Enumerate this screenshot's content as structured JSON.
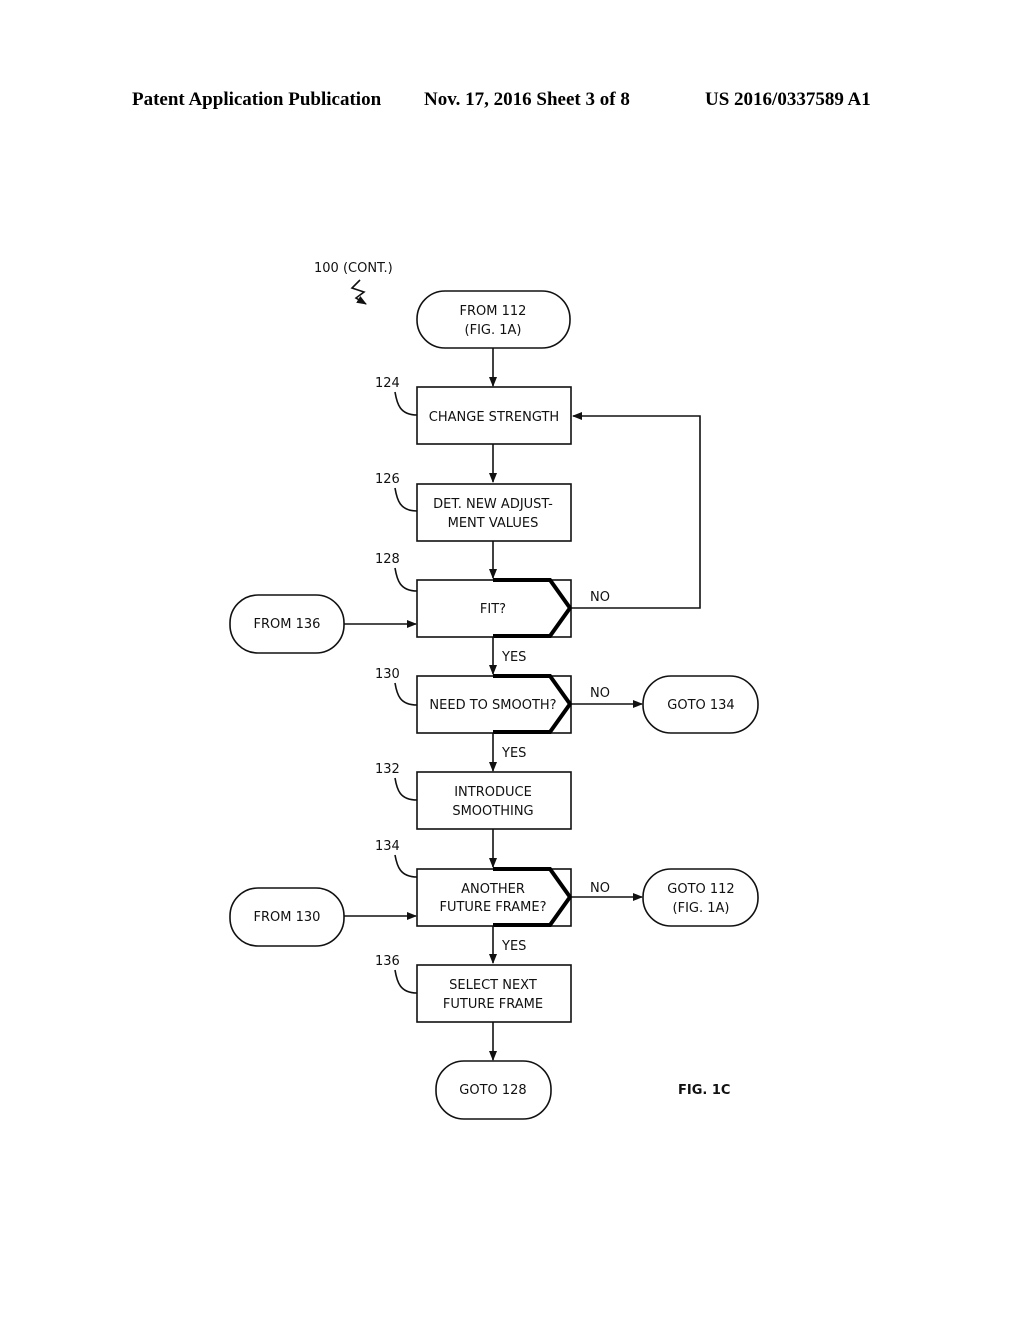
{
  "header": {
    "publication": "Patent Application Publication",
    "date_sheet": "Nov. 17, 2016  Sheet 3 of 8",
    "number": "US 2016/0337589 A1"
  },
  "diagram": {
    "ref_label": "100 (CONT.)",
    "figure_label": "FIG. 1C",
    "terminals": {
      "from_112": [
        "FROM 112",
        "(FIG. 1A)"
      ],
      "from_136": [
        "FROM 136"
      ],
      "goto_134": [
        "GOTO 134"
      ],
      "from_130": [
        "FROM 130"
      ],
      "goto_112": [
        "GOTO 112",
        "(FIG. 1A)"
      ],
      "goto_128": [
        "GOTO 128"
      ]
    },
    "steps": {
      "s124": {
        "ref": "124",
        "lines": [
          "CHANGE STRENGTH"
        ]
      },
      "s126": {
        "ref": "126",
        "lines": [
          "DET. NEW ADJUST-",
          "MENT VALUES"
        ]
      },
      "s128": {
        "ref": "128",
        "lines": [
          "FIT?"
        ]
      },
      "s130": {
        "ref": "130",
        "lines": [
          "NEED TO SMOOTH?"
        ]
      },
      "s132": {
        "ref": "132",
        "lines": [
          "INTRODUCE",
          "SMOOTHING"
        ]
      },
      "s134": {
        "ref": "134",
        "lines": [
          "ANOTHER",
          "FUTURE FRAME?"
        ]
      },
      "s136": {
        "ref": "136",
        "lines": [
          "SELECT NEXT",
          "FUTURE FRAME"
        ]
      }
    },
    "edge_labels": {
      "yes": "YES",
      "no": "NO"
    }
  }
}
